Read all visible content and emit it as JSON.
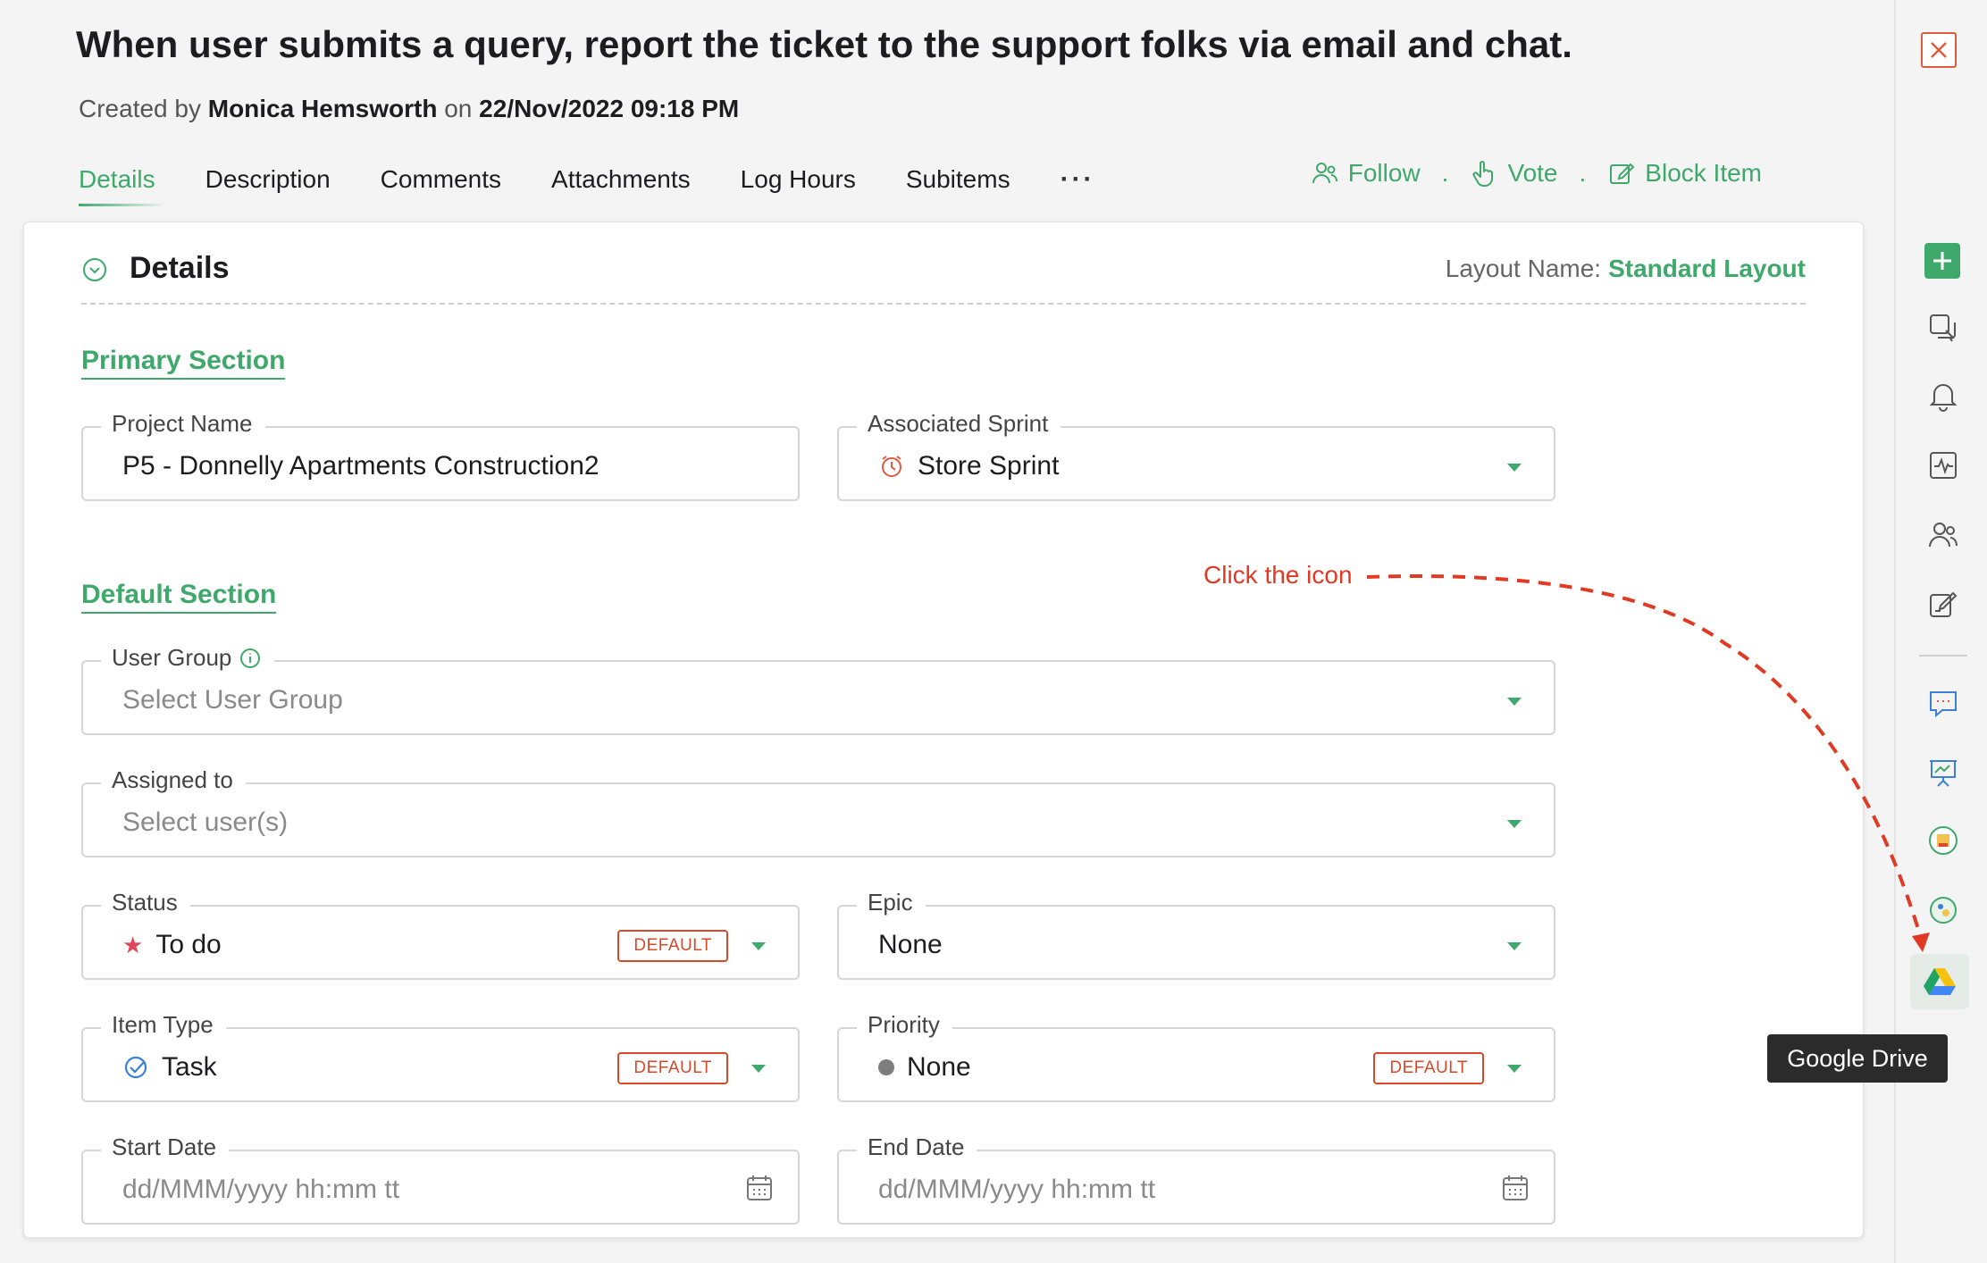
{
  "header": {
    "title": "When user submits a query, report the ticket to the support folks via email and chat.",
    "created_prefix": "Created by",
    "author": "Monica Hemsworth",
    "on_word": "on",
    "created_at": "22/Nov/2022 09:18 PM"
  },
  "tabs": [
    {
      "label": "Details"
    },
    {
      "label": "Description"
    },
    {
      "label": "Comments"
    },
    {
      "label": "Attachments"
    },
    {
      "label": "Log Hours"
    },
    {
      "label": "Subitems"
    },
    {
      "label": "···"
    }
  ],
  "actions": {
    "follow": "Follow",
    "vote": "Vote",
    "block": "Block Item",
    "separator": "."
  },
  "card": {
    "title": "Details",
    "layout_label": "Layout Name:",
    "layout_value": "Standard Layout"
  },
  "sections": {
    "primary": "Primary Section",
    "default": "Default Section"
  },
  "fields": {
    "project_name": {
      "label": "Project Name",
      "value": "P5 - Donnelly Apartments Construction2"
    },
    "associated_sprint": {
      "label": "Associated Sprint",
      "value": "Store Sprint"
    },
    "user_group": {
      "label": "User Group",
      "placeholder": "Select User Group"
    },
    "assigned_to": {
      "label": "Assigned to",
      "placeholder": "Select user(s)"
    },
    "status": {
      "label": "Status",
      "value": "To do",
      "badge": "DEFAULT"
    },
    "epic": {
      "label": "Epic",
      "value": "None"
    },
    "item_type": {
      "label": "Item Type",
      "value": "Task",
      "badge": "DEFAULT"
    },
    "priority": {
      "label": "Priority",
      "value": "None",
      "badge": "DEFAULT"
    },
    "start_date": {
      "label": "Start Date",
      "placeholder": "dd/MMM/yyyy hh:mm tt"
    },
    "end_date": {
      "label": "End Date",
      "placeholder": "dd/MMM/yyyy hh:mm tt"
    }
  },
  "annotation": "Click the icon",
  "tooltip": "Google Drive",
  "colors": {
    "accent": "#3fa86b",
    "badge": "#d64a2b",
    "annotation": "#e03a24",
    "status_star": "#e0485a"
  },
  "rail_icons": [
    "close-icon",
    "add-icon",
    "copy-icon",
    "bell-icon",
    "activity-icon",
    "users-icon",
    "edit-icon",
    "chat-icon",
    "presentation-icon",
    "app-icon",
    "app-icon-2",
    "google-drive-icon"
  ]
}
